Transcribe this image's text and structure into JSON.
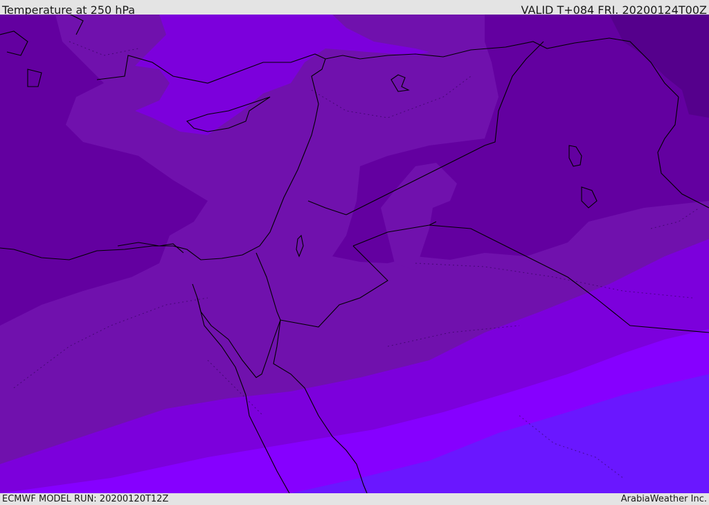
{
  "header": {
    "title": "Temperature at 250 hPa",
    "valid": "VALID T+084 FRI. 20200124T00Z"
  },
  "footer": {
    "model_run": "ECMWF MODEL RUN: 20200120T12Z",
    "credit": "ArabiaWeather Inc."
  },
  "colors": {
    "band_darkest": "#55008c",
    "band_dark": "#6300a0",
    "band_mid": "#7011ad",
    "band_bright": "#7c00dc",
    "band_brighter": "#8600ff",
    "band_blue": "#6a17ff",
    "coastline": "#000000"
  }
}
